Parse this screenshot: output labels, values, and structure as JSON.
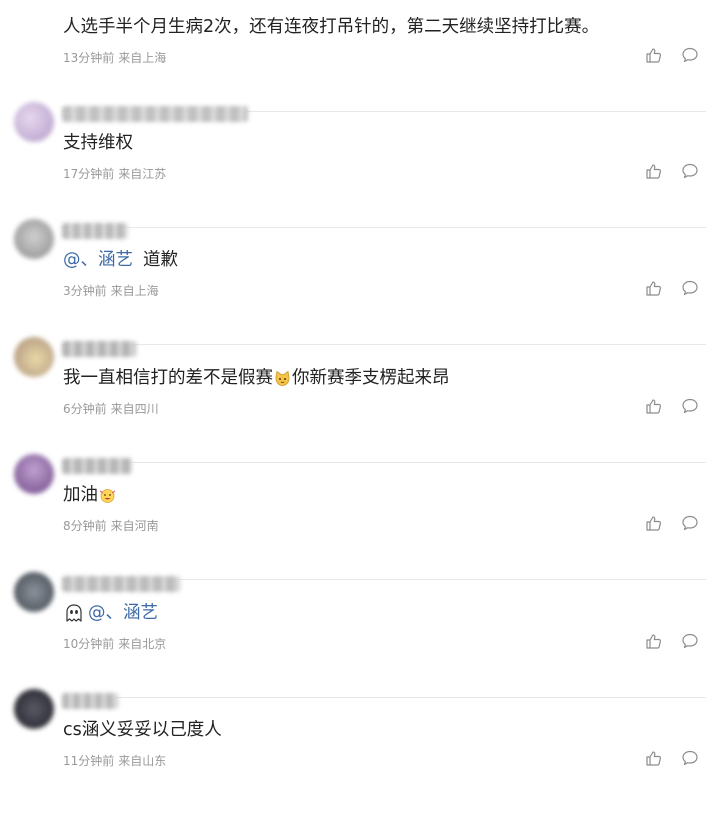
{
  "comments": [
    {
      "text": "人选手半个月生病2次，还有连夜打吊针的，第二天继续坚持打比赛。",
      "time": "13分钟前",
      "location": "来自上海",
      "avatar_color": "#d9cfcf",
      "username_color": "#cfcfcf"
    },
    {
      "text": "支持维权",
      "time": "17分钟前",
      "location": "来自江苏",
      "avatar_color": "#c9b8d8",
      "username_color": "#c6c6c6"
    },
    {
      "mention": "@、涵艺",
      "text": "道歉",
      "time": "3分钟前",
      "location": "来自上海",
      "avatar_color": "#b8b8b8",
      "username_color": "#bdbdbd"
    },
    {
      "text_before": "我一直相信打的差不是假赛",
      "emoji": "cat-face-emoji",
      "text_after": "你新赛季支楞起来昂",
      "time": "6分钟前",
      "location": "来自四川",
      "avatar_color": "#d8c9a6",
      "username_color": "#c4c4c4"
    },
    {
      "text_before": "加油",
      "emoji": "cheering-face-emoji",
      "text_after": "",
      "time": "8分钟前",
      "location": "来自河南",
      "avatar_color": "#9a7ab0",
      "username_color": "#c2c2c2"
    },
    {
      "emoji": "ghost-emoji",
      "mention": "@、涵艺",
      "text": "",
      "time": "10分钟前",
      "location": "来自北京",
      "avatar_color": "#5a6068",
      "username_color": "#c8c8c8"
    },
    {
      "text": "cs涵义妥妥以己度人",
      "time": "11分钟前",
      "location": "来自山东",
      "avatar_color": "#3a3a44",
      "username_color": "#c4c4c4"
    }
  ],
  "icons": {
    "like": "thumbs-up-icon",
    "reply": "comment-bubble-icon"
  }
}
